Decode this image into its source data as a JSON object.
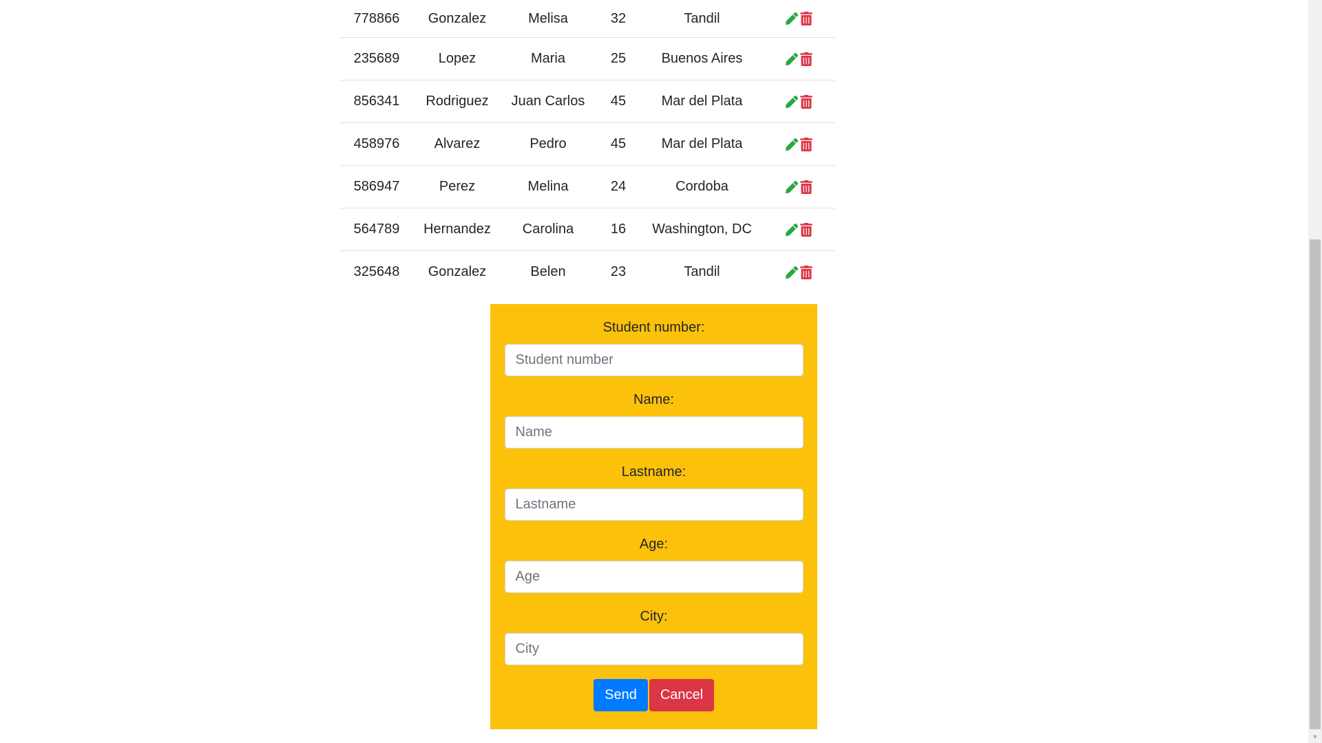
{
  "table": {
    "rows": [
      {
        "number": "778866",
        "lastname": "Gonzalez",
        "name": "Melisa",
        "age": "32",
        "city": "Tandil"
      },
      {
        "number": "235689",
        "lastname": "Lopez",
        "name": "Maria",
        "age": "25",
        "city": "Buenos Aires"
      },
      {
        "number": "856341",
        "lastname": "Rodriguez",
        "name": "Juan Carlos",
        "age": "45",
        "city": "Mar del Plata"
      },
      {
        "number": "458976",
        "lastname": "Alvarez",
        "name": "Pedro",
        "age": "45",
        "city": "Mar del Plata"
      },
      {
        "number": "586947",
        "lastname": "Perez",
        "name": "Melina",
        "age": "24",
        "city": "Cordoba"
      },
      {
        "number": "564789",
        "lastname": "Hernandez",
        "name": "Carolina",
        "age": "16",
        "city": "Washington, DC"
      },
      {
        "number": "325648",
        "lastname": "Gonzalez",
        "name": "Belen",
        "age": "23",
        "city": "Tandil"
      }
    ],
    "edit_icon": "pencil-icon",
    "delete_icon": "trash-icon",
    "edit_color": "#28a745",
    "delete_color": "#dc3545"
  },
  "form": {
    "background": "#fcc10b",
    "fields": [
      {
        "label": "Student number:",
        "placeholder": "Student number",
        "value": ""
      },
      {
        "label": "Name:",
        "placeholder": "Name",
        "value": ""
      },
      {
        "label": "Lastname:",
        "placeholder": "Lastname",
        "value": ""
      },
      {
        "label": "Age:",
        "placeholder": "Age",
        "value": ""
      },
      {
        "label": "City:",
        "placeholder": "City",
        "value": ""
      }
    ],
    "send_label": "Send",
    "cancel_label": "Cancel",
    "send_color": "#007bff",
    "cancel_color": "#dc3545"
  }
}
